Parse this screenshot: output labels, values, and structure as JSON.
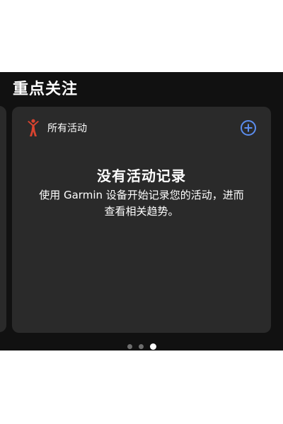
{
  "section": {
    "title": "重点关注"
  },
  "card": {
    "label": "所有活动",
    "icon": "activity-person-icon",
    "add_icon": "plus-circle-icon",
    "empty_title": "没有活动记录",
    "empty_desc": "使用 Garmin 设备开始记录您的活动，进而查看相关趋势。"
  },
  "pager": {
    "count": 3,
    "active_index": 2
  },
  "colors": {
    "background": "#111111",
    "card": "#2a2a2a",
    "accent_blue": "#5b8def",
    "icon_red": "#d9432f"
  }
}
